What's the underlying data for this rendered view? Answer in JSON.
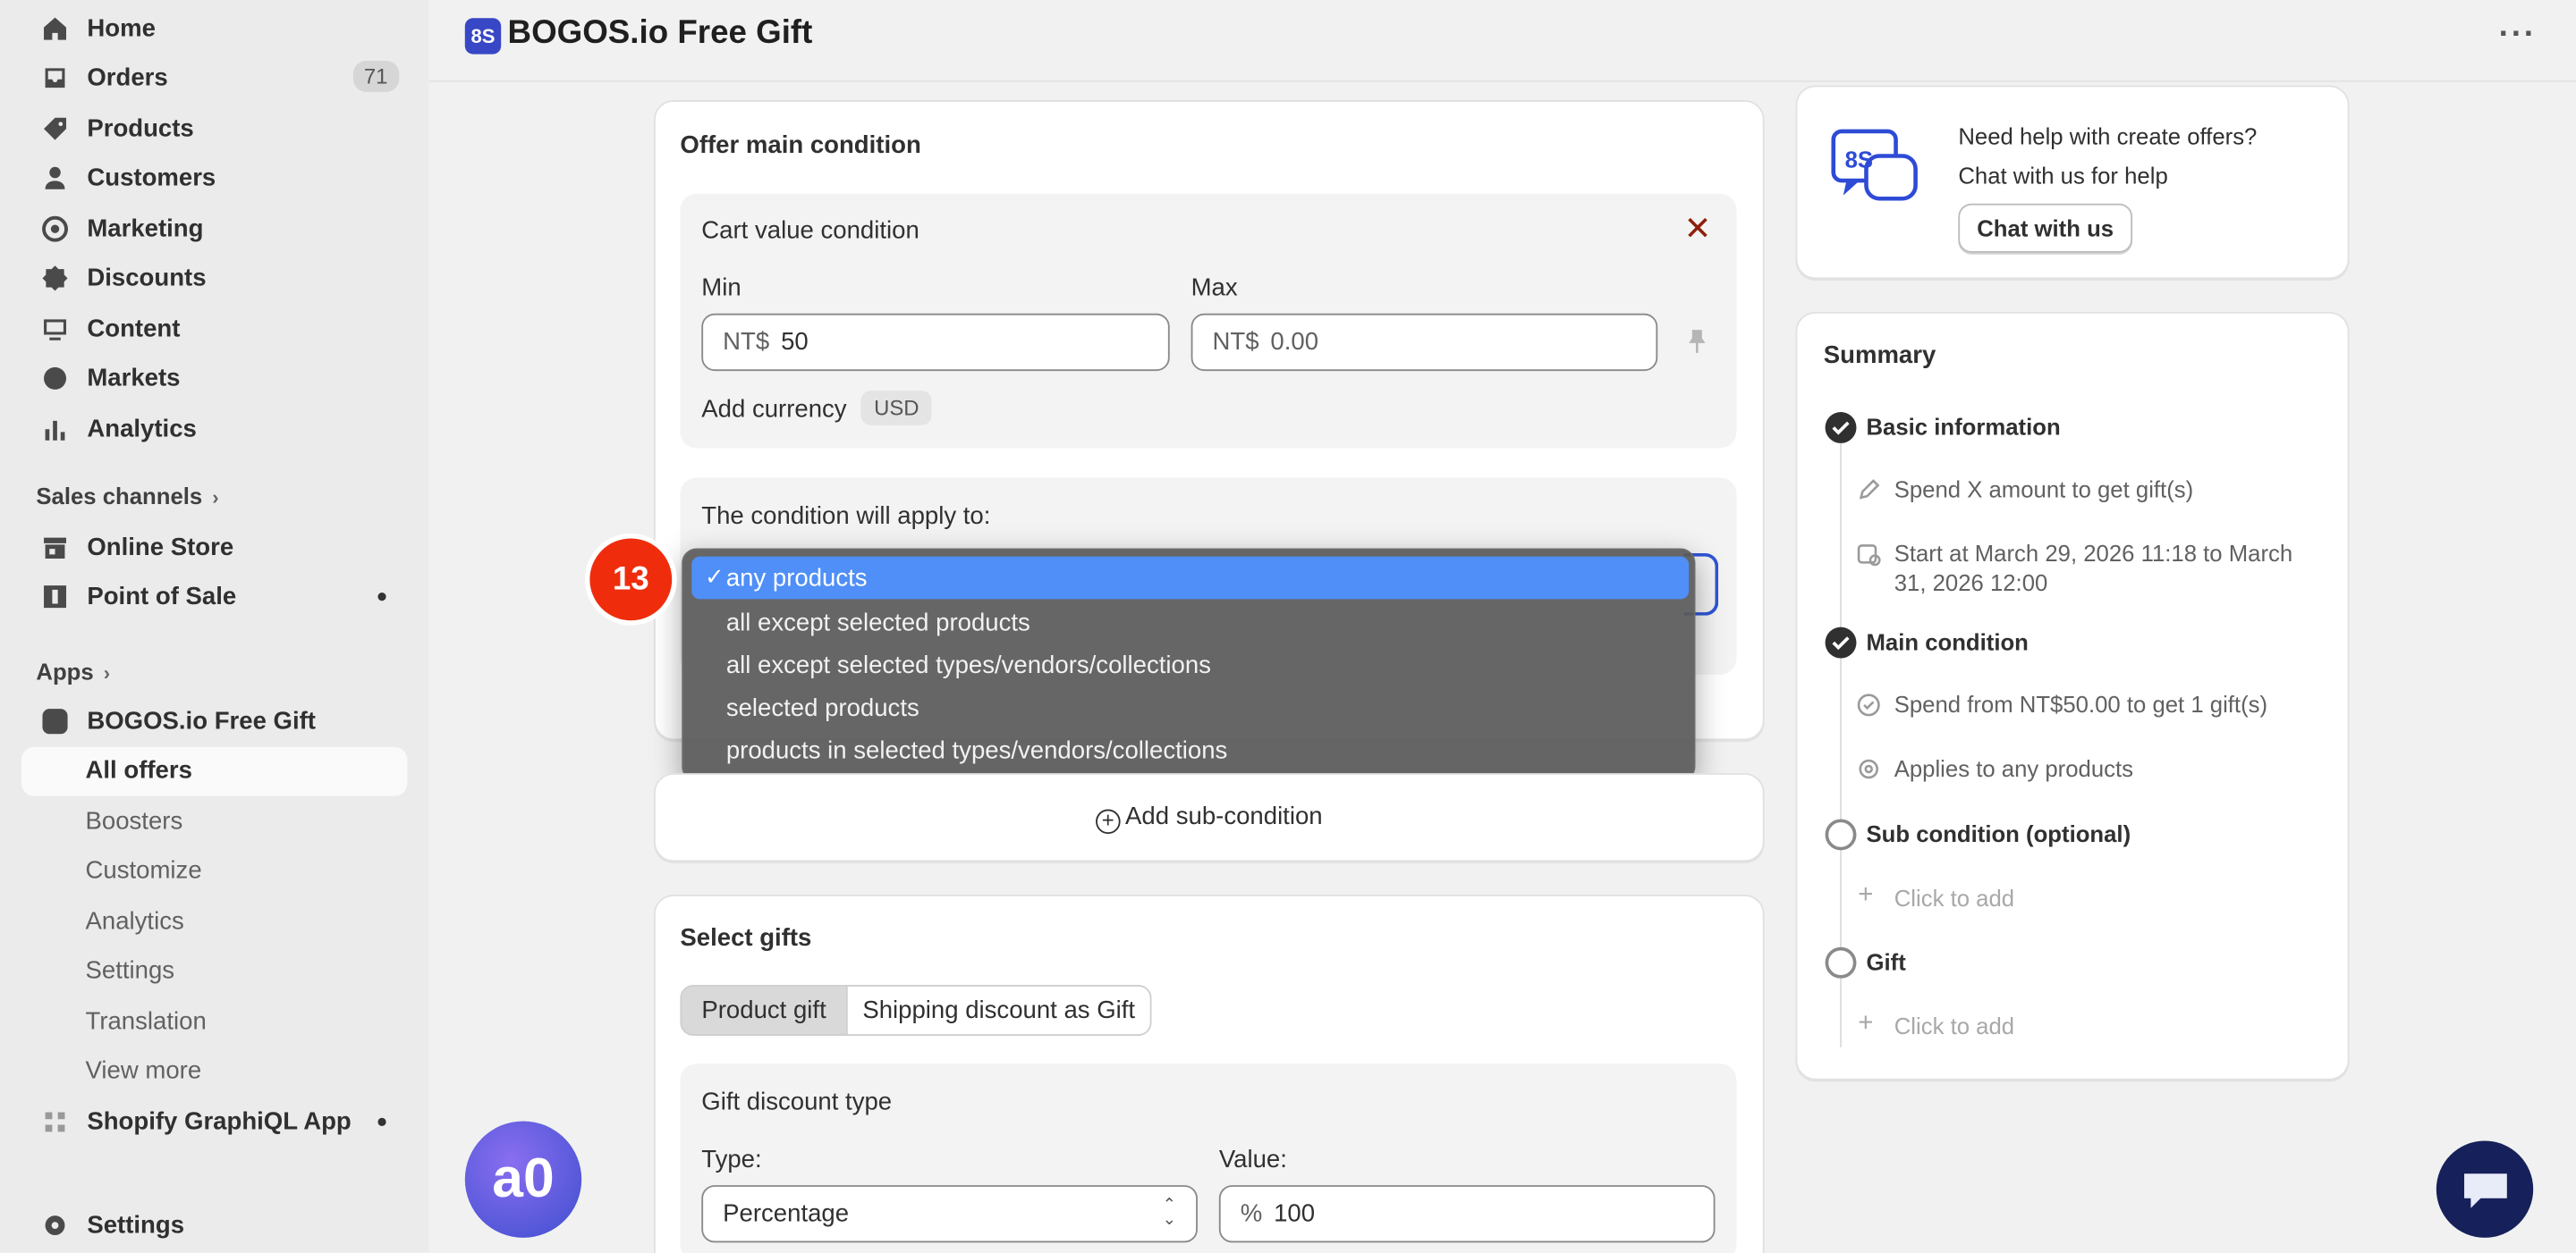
{
  "sidebar": {
    "items": [
      {
        "label": "Home",
        "icon": "home-icon"
      },
      {
        "label": "Orders",
        "icon": "inbox-icon",
        "badge": "71"
      },
      {
        "label": "Products",
        "icon": "tag-icon"
      },
      {
        "label": "Customers",
        "icon": "person-icon"
      },
      {
        "label": "Marketing",
        "icon": "target-icon"
      },
      {
        "label": "Discounts",
        "icon": "discount-icon"
      },
      {
        "label": "Content",
        "icon": "image-icon"
      },
      {
        "label": "Markets",
        "icon": "globe-icon"
      },
      {
        "label": "Analytics",
        "icon": "bar-chart-icon"
      }
    ],
    "sales_channels_label": "Sales channels",
    "channels": [
      {
        "label": "Online Store",
        "icon": "store-icon"
      },
      {
        "label": "Point of Sale",
        "icon": "pos-icon"
      }
    ],
    "apps_label": "Apps",
    "app_name": "BOGOS.io Free Gift",
    "app_subitems": {
      "active": "All offers",
      "others": [
        "Boosters",
        "Customize",
        "Analytics",
        "Settings",
        "Translation",
        "View more"
      ]
    },
    "graphiql": "Shopify GraphiQL App",
    "settings": "Settings"
  },
  "header": {
    "logo_text": "8S",
    "title": "BOGOS.io Free Gift",
    "more": "···"
  },
  "main_condition": {
    "title": "Offer main condition",
    "cart": {
      "title": "Cart value condition",
      "min_label": "Min",
      "max_label": "Max",
      "min_prefix": "NT$",
      "min_value": "50",
      "max_prefix": "NT$",
      "max_placeholder": "0.00",
      "add_currency_label": "Add currency",
      "currency_chip": "USD"
    },
    "apply_to_label": "The condition will apply to:",
    "dropdown": {
      "selected_check": "✓",
      "options": [
        "any products",
        "all except selected products",
        "all except selected types/vendors/collections",
        "selected products",
        "products in selected types/vendors/collections"
      ]
    }
  },
  "step_badge": "13",
  "sub_condition": {
    "add_label": "Add sub-condition"
  },
  "gifts": {
    "title": "Select gifts",
    "tabs": [
      "Product gift",
      "Shipping discount as Gift"
    ],
    "discount_type_title": "Gift discount type",
    "type_label": "Type:",
    "type_value": "Percentage",
    "value_label": "Value:",
    "value_prefix": "%",
    "value_value": "100"
  },
  "help": {
    "line1": "Need help with create offers?",
    "line2": "Chat with us for help",
    "button": "Chat with us"
  },
  "summary": {
    "title": "Summary",
    "basic_title": "Basic information",
    "basic_sub1": "Spend X amount to get gift(s)",
    "basic_sub2": "Start at March 29, 2026 11:18 to March 31, 2026 12:00",
    "main_title": "Main condition",
    "main_sub1": "Spend from NT$50.00 to get 1 gift(s)",
    "main_sub2": "Applies to any products",
    "sub_title": "Sub condition (optional)",
    "sub_add": "Click to add",
    "gift_title": "Gift",
    "gift_add": "Click to add"
  },
  "fab_left_text": "a0",
  "colors": {
    "accent": "#4f8ff7",
    "badge": "#ef2d0c",
    "brand": "#3847c5",
    "chat": "#16205a"
  }
}
